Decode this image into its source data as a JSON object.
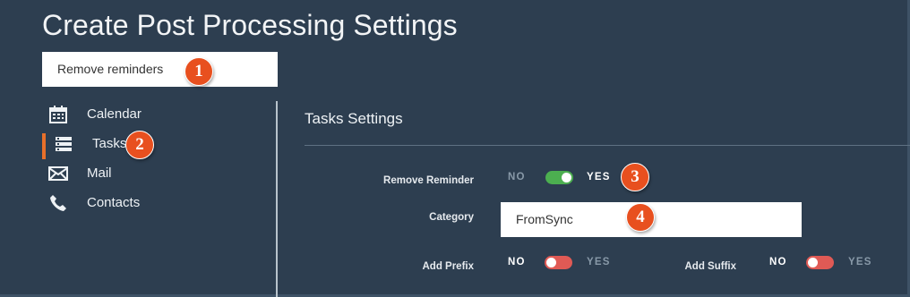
{
  "page": {
    "title": "Create Post Processing Settings"
  },
  "name_field": {
    "value": "Remove reminders"
  },
  "annotations": [
    "1",
    "2",
    "3",
    "4"
  ],
  "sidebar": {
    "items": [
      {
        "label": "Calendar",
        "icon": "calendar-icon",
        "active": false
      },
      {
        "label": "Tasks",
        "icon": "tasks-icon",
        "active": true
      },
      {
        "label": "Mail",
        "icon": "mail-icon",
        "active": false
      },
      {
        "label": "Contacts",
        "icon": "phone-icon",
        "active": false
      }
    ]
  },
  "tasks_settings": {
    "title": "Tasks Settings",
    "remove_reminder": {
      "label": "Remove Reminder",
      "no": "NO",
      "yes": "YES",
      "value": "YES"
    },
    "category": {
      "label": "Category",
      "value": "FromSync"
    },
    "add_prefix": {
      "label": "Add Prefix",
      "no": "NO",
      "yes": "YES",
      "value": "NO"
    },
    "add_suffix": {
      "label": "Add Suffix",
      "no": "NO",
      "yes": "YES",
      "value": "NO"
    }
  },
  "colors": {
    "background": "#2c3e50",
    "accent": "#e8702a",
    "badge": "#e8501f",
    "toggle_on": "#4caf50",
    "toggle_off": "#e05a55"
  }
}
